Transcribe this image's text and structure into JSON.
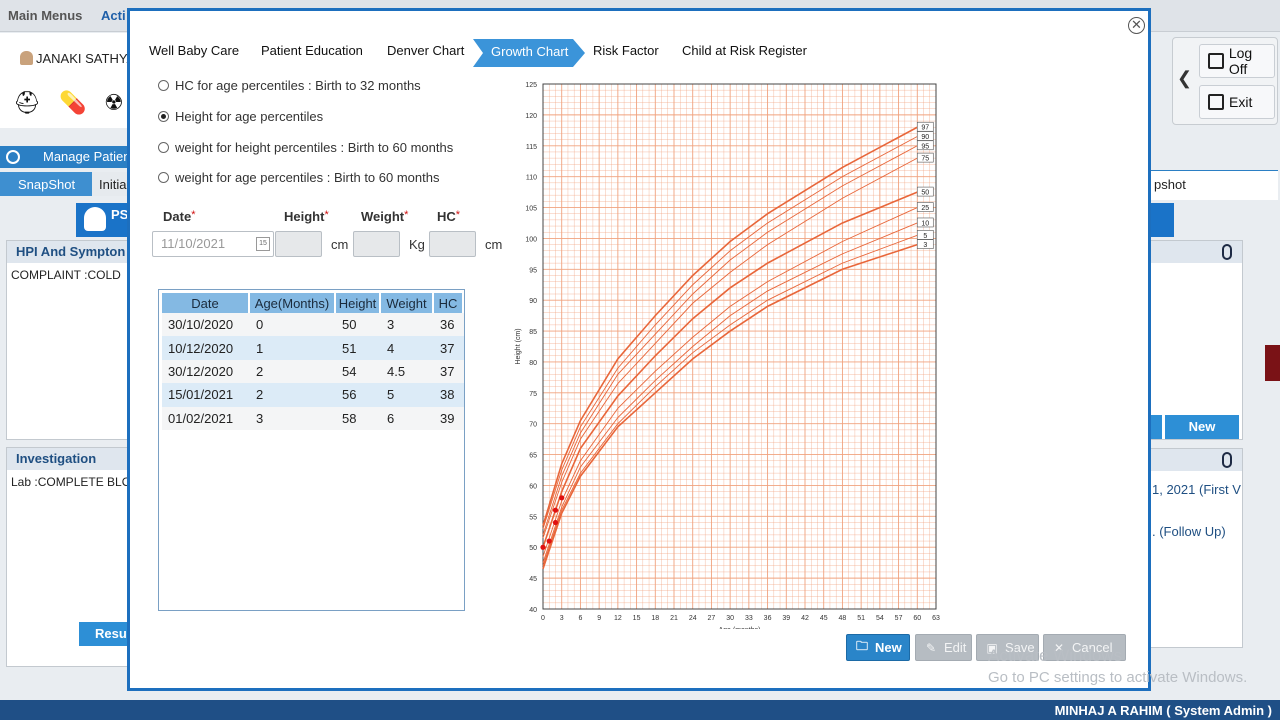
{
  "app": {
    "main_menus": "Main Menus",
    "active_menu": "Acti",
    "patient_name": "JANAKI SATHYA",
    "manage_label": "Manage Patien",
    "snapshot_tab": "SnapShot",
    "initial_tab": "Initia",
    "ps_badge": "PS\nS",
    "hpi_title": "HPI And Sympton",
    "hpi_text": "COMPLAINT :COLD",
    "investigation_title": "Investigation",
    "investigation_text": "Lab :COMPLETE BLOOD",
    "result_button": "Resu",
    "right_snapshot": "pshot",
    "right_new": "New",
    "right_visit1": "1, 2021 (First V",
    "right_visit2": ". (Follow Up)",
    "log_off": "Log Off",
    "exit": "Exit",
    "watermark_line1": "Activate Windows",
    "watermark_line2": "Go to PC settings to activate Windows.",
    "status_user": "MINHAJ A RAHIM  ( System Admin )"
  },
  "modal": {
    "close_symbol": "✕",
    "tabs": [
      "Well Baby Care",
      "Patient Education",
      "Denver Chart",
      "Growth Chart",
      "Risk Factor",
      "Child at Risk Register"
    ],
    "active_tab": "Growth Chart",
    "radios": [
      {
        "label": "HC for age percentiles : Birth to 32 months",
        "selected": false
      },
      {
        "label": "Height for age percentiles",
        "selected": true
      },
      {
        "label": "weight for height percentiles : Birth to 60 months",
        "selected": false
      },
      {
        "label": "weight for age percentiles : Birth to 60 months",
        "selected": false
      }
    ],
    "form": {
      "date_label": "Date",
      "height_label": "Height",
      "weight_label": "Weight",
      "hc_label": "HC",
      "required_mark": "*",
      "date_value": "11/10/2021",
      "calendar_icon_text": "15",
      "unit_cm": "cm",
      "unit_kg": "Kg"
    },
    "table": {
      "headers": [
        "Date",
        "Age(Months)",
        "Height",
        "Weight",
        "HC"
      ],
      "rows": [
        [
          "30/10/2020",
          "0",
          "50",
          "3",
          "36"
        ],
        [
          "10/12/2020",
          "1",
          "51",
          "4",
          "37"
        ],
        [
          "30/12/2020",
          "2",
          "54",
          "4.5",
          "37"
        ],
        [
          "15/01/2021",
          "2",
          "56",
          "5",
          "38"
        ],
        [
          "01/02/2021",
          "3",
          "58",
          "6",
          "39"
        ]
      ]
    },
    "buttons": {
      "new": "New",
      "edit": "Edit",
      "save": "Save",
      "cancel": "Cancel"
    }
  },
  "chart_data": {
    "type": "line",
    "xlabel": "Age (months)",
    "ylabel": "Height (cm)",
    "xlim": [
      0,
      63
    ],
    "ylim": [
      40,
      125
    ],
    "x_ticks": [
      0,
      3,
      6,
      9,
      12,
      15,
      18,
      21,
      24,
      27,
      30,
      33,
      36,
      39,
      42,
      45,
      48,
      51,
      54,
      57,
      60,
      63
    ],
    "y_ticks": [
      40,
      45,
      50,
      55,
      60,
      65,
      70,
      75,
      80,
      85,
      90,
      95,
      100,
      105,
      110,
      115,
      120,
      125
    ],
    "grid": true,
    "x": [
      0,
      3,
      6,
      12,
      18,
      24,
      30,
      36,
      48,
      60
    ],
    "series": [
      {
        "name": "97",
        "values": [
          53.5,
          63.5,
          70.5,
          80.5,
          87.5,
          94,
          99.5,
          104,
          111.5,
          118
        ]
      },
      {
        "name": "90",
        "values": [
          53,
          62.5,
          69.5,
          79,
          86,
          92.5,
          98,
          102.5,
          110,
          116.5
        ]
      },
      {
        "name": "95",
        "values": [
          52,
          61.5,
          68.5,
          78,
          84.5,
          91,
          96.5,
          101,
          108.5,
          115
        ]
      },
      {
        "name": "75",
        "values": [
          51.5,
          60.5,
          67.5,
          76.5,
          83,
          89.5,
          94.5,
          99,
          106.5,
          113
        ]
      },
      {
        "name": "50",
        "values": [
          50,
          59,
          66,
          74.5,
          81,
          87,
          92,
          96,
          102.5,
          107.5
        ]
      },
      {
        "name": "25",
        "values": [
          48.5,
          57.5,
          64,
          72.5,
          78.5,
          84,
          89,
          93,
          99.5,
          105
        ]
      },
      {
        "name": "10",
        "values": [
          47.5,
          56.5,
          63,
          71,
          77,
          82.5,
          87.5,
          91.5,
          97.5,
          102.5
        ]
      },
      {
        "name": "5",
        "values": [
          47,
          56,
          62,
          70,
          76,
          81.5,
          86,
          90,
          96,
          100.5
        ]
      },
      {
        "name": "3",
        "values": [
          46.5,
          55.5,
          61.5,
          69.5,
          75,
          80.5,
          85,
          89,
          95,
          99
        ]
      }
    ],
    "patient_points": [
      {
        "x": 0,
        "y": 50
      },
      {
        "x": 1,
        "y": 51
      },
      {
        "x": 2,
        "y": 54
      },
      {
        "x": 2,
        "y": 56
      },
      {
        "x": 3,
        "y": 58
      }
    ],
    "colors": {
      "grid": "#f0a27e",
      "curve": "#e8663a",
      "point": "#e01010"
    }
  }
}
